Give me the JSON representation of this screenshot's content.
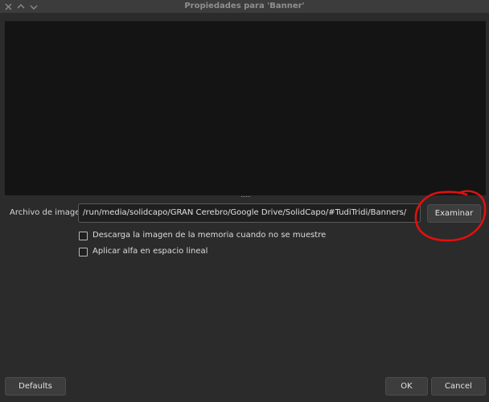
{
  "window": {
    "title": "Propiedades para 'Banner'"
  },
  "image_file": {
    "label": "Archivo de imagen",
    "path": "/run/media/solidcapo/GRAN Cerebro/Google Drive/SolidCapo/#TudiTridi/Banners/",
    "browse_label": "Examinar"
  },
  "options": [
    {
      "label": "Descarga la imagen de la memoria cuando no se muestre",
      "checked": false
    },
    {
      "label": "Aplicar alfa en espacio lineal",
      "checked": false
    }
  ],
  "footer": {
    "defaults_label": "Defaults",
    "ok_label": "OK",
    "cancel_label": "Cancel"
  },
  "icons": {
    "titlebar": [
      "close-icon",
      "minimize-icon",
      "maximize-icon"
    ],
    "annotation": "red-circle-annotation"
  },
  "colors": {
    "window_bg": "#2b2b2b",
    "preview_bg": "#141414",
    "annotation": "#e01010"
  }
}
